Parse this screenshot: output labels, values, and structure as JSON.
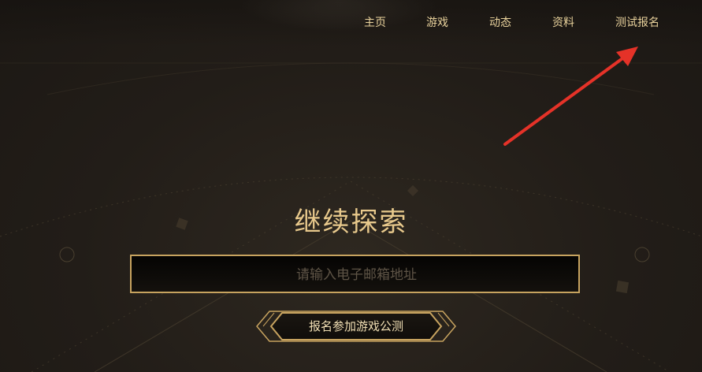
{
  "nav": {
    "items": [
      {
        "label": "主页"
      },
      {
        "label": "游戏"
      },
      {
        "label": "动态"
      },
      {
        "label": "资料"
      },
      {
        "label": "测试报名"
      }
    ]
  },
  "main": {
    "title": "继续探索",
    "email": {
      "placeholder": "请输入电子邮箱地址",
      "value": ""
    },
    "cta_label": "报名参加游戏公测"
  },
  "colors": {
    "accent_gold": "#c7a35f",
    "text_gold": "#e8c98c",
    "annotation_arrow": "#e53228"
  }
}
